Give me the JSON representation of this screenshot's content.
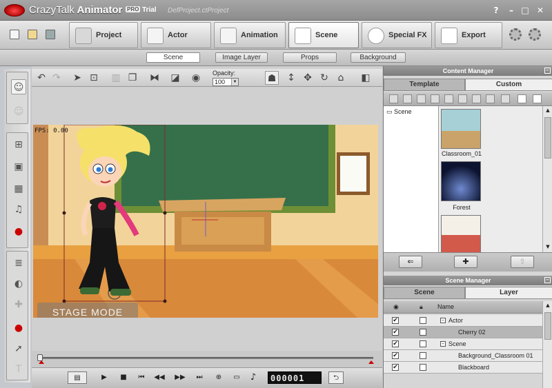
{
  "window": {
    "app_name_part1": "CrazyTalk",
    "app_name_part2": "Animator",
    "edition_badge": "PRO",
    "license": "Trial",
    "project_name": "DefProject.ctProject",
    "controls": {
      "help": "?",
      "minimize": "–",
      "maximize": "□",
      "close": "✕"
    }
  },
  "toolbar": {
    "modes": [
      {
        "label": "Project"
      },
      {
        "label": "Actor"
      },
      {
        "label": "Animation"
      },
      {
        "label": "Scene"
      },
      {
        "label": "Special FX"
      },
      {
        "label": "Export"
      }
    ],
    "active_mode": "Scene"
  },
  "subtabs": [
    "Scene",
    "Image Layer",
    "Props",
    "Background"
  ],
  "stage_tools": {
    "opacity_label": "Opacity:",
    "opacity_value": "100"
  },
  "stage": {
    "fps": "FPS: 0.00",
    "mode_label": "STAGE MODE"
  },
  "playback": {
    "counter": "000001"
  },
  "content_manager": {
    "title": "Content Manager",
    "tabs": [
      "Template",
      "Custom"
    ],
    "active_tab": "Template",
    "tree_item": "Scene",
    "thumbnails": [
      {
        "label": "Classroom_01"
      },
      {
        "label": "Forest"
      },
      {
        "label": ""
      }
    ]
  },
  "scene_manager": {
    "title": "Scene Manager",
    "tabs": [
      "Scene",
      "Layer"
    ],
    "active_tab": "Scene",
    "column_name": "Name",
    "rows": [
      {
        "name": "Actor",
        "visible": "✔",
        "locked": "",
        "expander": "–"
      },
      {
        "name": "Cherry 02",
        "visible": "✔",
        "locked": "",
        "expander": ""
      },
      {
        "name": "Scene",
        "visible": "✔",
        "locked": "",
        "expander": "–"
      },
      {
        "name": "Background_Classroom 01",
        "visible": "✔",
        "locked": "",
        "expander": ""
      },
      {
        "name": "Blackboard",
        "visible": "✔",
        "locked": "",
        "expander": ""
      }
    ]
  },
  "colors": {
    "accent_red": "#c00000",
    "panel_header": "#8a8a8a"
  }
}
